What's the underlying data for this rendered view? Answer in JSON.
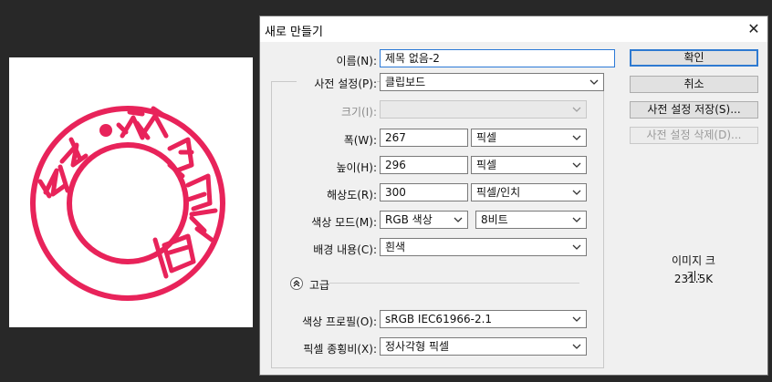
{
  "dialog": {
    "title": "새로 만들기",
    "close_glyph": "✕"
  },
  "stamp": {
    "color": "#e8235a",
    "text": "전남•광양•세무서"
  },
  "form": {
    "name": {
      "label": "이름(N):",
      "value": "제목 없음-2"
    },
    "preset": {
      "label": "사전 설정(P):",
      "value": "클립보드"
    },
    "size": {
      "label": "크기(I):",
      "value": ""
    },
    "width": {
      "label": "폭(W):",
      "value": "267",
      "unit": "픽셀"
    },
    "height": {
      "label": "높이(H):",
      "value": "296",
      "unit": "픽셀"
    },
    "resolution": {
      "label": "해상도(R):",
      "value": "300",
      "unit": "픽셀/인치"
    },
    "color_mode": {
      "label": "색상 모드(M):",
      "value": "RGB 색상",
      "bits": "8비트"
    },
    "background": {
      "label": "배경 내용(C):",
      "value": "흰색"
    },
    "advanced": {
      "label": "고급"
    },
    "color_profile": {
      "label": "색상 프로필(O):",
      "value": "sRGB IEC61966-2.1"
    },
    "pixel_aspect": {
      "label": "픽셀 종횡비(X):",
      "value": "정사각형 픽셀"
    }
  },
  "buttons": {
    "ok": "확인",
    "cancel": "취소",
    "save_preset": "사전 설정 저장(S)...",
    "delete_preset": "사전 설정 삭제(D)..."
  },
  "info": {
    "image_size_label": "이미지 크기:",
    "image_size_value": "231.5K"
  },
  "colors": {
    "accent": "#2e7ad1",
    "dialog_bg": "#f0f0f0",
    "workspace_bg": "#282828",
    "stamp_red": "#e8235a"
  }
}
